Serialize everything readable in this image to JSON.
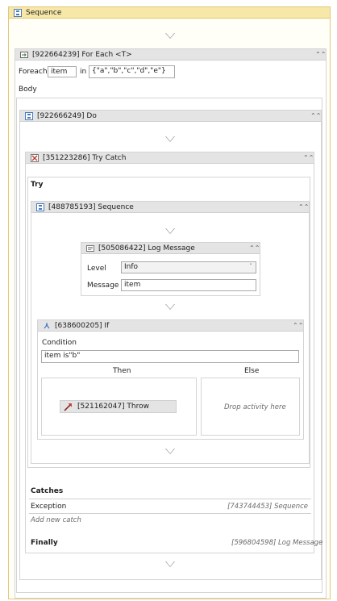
{
  "outer_sequence": {
    "title": "Sequence"
  },
  "foreach": {
    "title": "[922664239] For Each <T>",
    "foreach_label": "Foreach",
    "item_value": "item",
    "in_label": "in",
    "collection_value": "{\"a\",\"b\",\"c\",\"d\",\"e\"}",
    "body_label": "Body"
  },
  "do_block": {
    "title": "[922666249] Do"
  },
  "try_catch": {
    "title": "[351223286] Try Catch",
    "try_label": "Try",
    "catches_label": "Catches",
    "exception_label": "Exception",
    "exception_handler": "[743744453] Sequence",
    "add_catch": "Add new catch",
    "finally_label": "Finally",
    "finally_handler": "[596804598] Log Message"
  },
  "inner_sequence": {
    "title": "[488785193] Sequence"
  },
  "log_message": {
    "title": "[505086422] Log Message",
    "level_label": "Level",
    "level_value": "Info",
    "message_label": "Message",
    "message_value": "item"
  },
  "if_block": {
    "title": "[638600205] If",
    "condition_label": "Condition",
    "condition_value": "item is\"b\"",
    "then_label": "Then",
    "else_label": "Else",
    "else_placeholder": "Drop activity here"
  },
  "throw_block": {
    "title": "[521162047] Throw"
  },
  "icons": {
    "sequence": "sequence-icon",
    "foreach": "foreach-icon",
    "try_catch": "try-catch-icon",
    "log": "log-message-icon",
    "if": "if-icon",
    "throw": "throw-icon",
    "collapse": "collapse-chevron-icon"
  },
  "colors": {
    "outer_header": "#f7e7a8",
    "header": "#e4e4e4"
  }
}
